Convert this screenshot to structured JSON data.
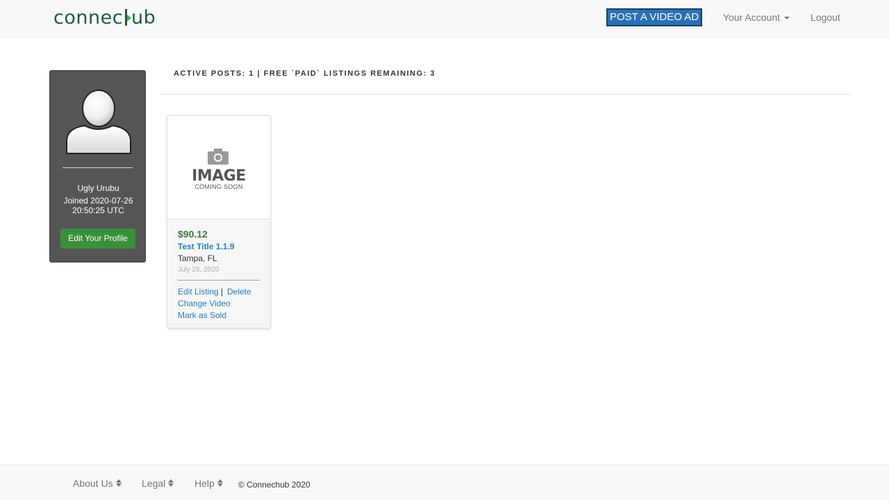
{
  "navbar": {
    "logo_text_left": "connec",
    "logo_text_right": "ub",
    "post_ad_label": "POST A VIDEO AD",
    "account_label": "Your Account",
    "logout_label": "Logout"
  },
  "profile": {
    "name": "Ugly Urubu",
    "joined": "Joined 2020-07-26 20:50:25 UTC",
    "edit_label": "Edit Your Profile"
  },
  "stats": {
    "text": "ACTIVE POSTS: 1 | FREE `PAID` LISTINGS REMAINING: 3"
  },
  "listing": {
    "placeholder_main": "IMAGE",
    "placeholder_sub": "COMING SOON",
    "price": "$90.12",
    "title": "Test Title 1.1.9",
    "location": "Tampa, FL",
    "date": "July 26, 2020",
    "actions": {
      "edit": "Edit Listing",
      "separator": "|",
      "delete": "Delete",
      "change_video": "Change Video",
      "mark_sold": "Mark as Sold"
    }
  },
  "footer": {
    "about": "About Us",
    "legal": "Legal",
    "help": "Help",
    "copyright": "© Connechub 2020"
  },
  "colors": {
    "brand_green": "#1f5a45",
    "accent_green": "#4caf50",
    "post_button": "#2a6fb5",
    "profile_bg": "#555555",
    "edit_button": "#3a8f3a",
    "link_blue": "#2a7bbf",
    "price_green": "#3c763d"
  }
}
